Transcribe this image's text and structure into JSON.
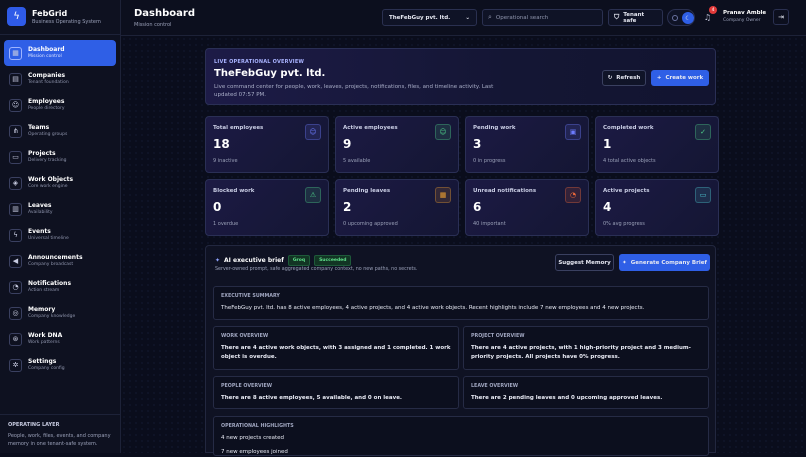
{
  "brand": {
    "name": "FebGrid",
    "tagline": "Business Operating System"
  },
  "sidebar": {
    "items": [
      {
        "label": "Dashboard",
        "sub": "Mission control",
        "icon": "▦"
      },
      {
        "label": "Companies",
        "sub": "Tenant foundation",
        "icon": "▤"
      },
      {
        "label": "Employees",
        "sub": "People directory",
        "icon": "☺"
      },
      {
        "label": "Teams",
        "sub": "Operating groups",
        "icon": "⋔"
      },
      {
        "label": "Projects",
        "sub": "Delivery tracking",
        "icon": "▭"
      },
      {
        "label": "Work Objects",
        "sub": "Core work engine",
        "icon": "◈"
      },
      {
        "label": "Leaves",
        "sub": "Availability",
        "icon": "▥"
      },
      {
        "label": "Events",
        "sub": "Universal timeline",
        "icon": "ϟ"
      },
      {
        "label": "Announcements",
        "sub": "Company broadcast",
        "icon": "◀"
      },
      {
        "label": "Notifications",
        "sub": "Action stream",
        "icon": "◔"
      },
      {
        "label": "Memory",
        "sub": "Company knowledge",
        "icon": "◎"
      },
      {
        "label": "Work DNA",
        "sub": "Work patterns",
        "icon": "⊛"
      },
      {
        "label": "Settings",
        "sub": "Company config",
        "icon": "✲"
      }
    ],
    "footer": {
      "heading": "OPERATING LAYER",
      "text": "People, work, files, events, and company memory in one tenant-safe system."
    }
  },
  "header": {
    "title": "Dashboard",
    "subtitle": "Mission control",
    "company": "TheFebGuy pvt. ltd.",
    "search_placeholder": "Operational search",
    "tenant_label": "Tenant safe",
    "notification_count": "4",
    "user_name": "Pranav Amble",
    "user_role": "Company Owner"
  },
  "hero": {
    "tag": "LIVE OPERATIONAL OVERVIEW",
    "company": "TheFebGuy pvt. ltd.",
    "description": "Live command center for people, work, leaves, projects, notifications, files, and timeline activity. Last updated 07:57 PM.",
    "refresh_label": "Refresh",
    "create_label": "Create work"
  },
  "stats": [
    {
      "label": "Total employees",
      "value": "18",
      "sub": "9 inactive",
      "icon": "☺",
      "color": "#6d7cff"
    },
    {
      "label": "Active employees",
      "value": "9",
      "sub": "5 available",
      "icon": "☺",
      "color": "#4fd18a"
    },
    {
      "label": "Pending work",
      "value": "3",
      "sub": "0 in progress",
      "icon": "▣",
      "color": "#6d7cff"
    },
    {
      "label": "Completed work",
      "value": "1",
      "sub": "4 total active objects",
      "icon": "✓",
      "color": "#4fd18a"
    },
    {
      "label": "Blocked work",
      "value": "0",
      "sub": "1 overdue",
      "icon": "⚠",
      "color": "#4fd18a"
    },
    {
      "label": "Pending leaves",
      "value": "2",
      "sub": "0 upcoming approved",
      "icon": "▦",
      "color": "#f0a030"
    },
    {
      "label": "Unread notifications",
      "value": "6",
      "sub": "40 important",
      "icon": "◔",
      "color": "#f06a3a"
    },
    {
      "label": "Active projects",
      "value": "4",
      "sub": "0% avg progress",
      "icon": "▭",
      "color": "#4fc8d1"
    }
  ],
  "ai": {
    "title": "AI executive brief",
    "pill1": "Groq",
    "pill2": "Succeeded",
    "subtitle": "Server-owned prompt, safe aggregated company context, no new paths, no secrets.",
    "suggest_label": "Suggest Memory",
    "generate_label": "Generate Company Brief",
    "summary": {
      "heading": "EXECUTIVE SUMMARY",
      "text": "TheFebGuy pvt. ltd. has 8 active employees, 4 active projects, and 4 active work objects. Recent highlights include 7 new employees and 4 new projects."
    },
    "work": {
      "heading": "WORK OVERVIEW",
      "text": "There are 4 active work objects, with 3 assigned and 1 completed. 1 work object is overdue."
    },
    "project": {
      "heading": "PROJECT OVERVIEW",
      "text": "There are 4 active projects, with 1 high-priority project and 3 medium-priority projects. All projects have 0% progress."
    },
    "people": {
      "heading": "PEOPLE OVERVIEW",
      "text": "There are 8 active employees, 5 available, and 0 on leave."
    },
    "leave": {
      "heading": "LEAVE OVERVIEW",
      "text": "There are 2 pending leaves and 0 upcoming approved leaves."
    },
    "highlights": {
      "heading": "OPERATIONAL HIGHLIGHTS",
      "items": [
        "4 new projects created",
        "7 new employees joined"
      ]
    }
  }
}
